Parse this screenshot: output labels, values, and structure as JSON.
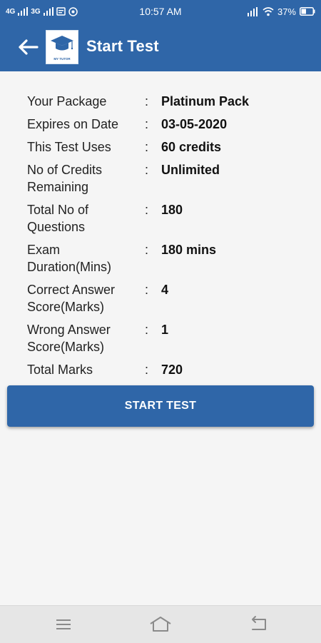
{
  "status_bar": {
    "left_net1": "4G",
    "left_net2": "3G",
    "time": "10:57 AM",
    "battery": "37%"
  },
  "header": {
    "title": "Start Test",
    "logo_text": "MY TUTOR"
  },
  "details": [
    {
      "label": "Your Package",
      "value": "Platinum Pack"
    },
    {
      "label": "Expires on Date",
      "value": "03-05-2020"
    },
    {
      "label": "This Test Uses",
      "value": "60  credits"
    },
    {
      "label": "No of Credits Remaining",
      "value": "Unlimited"
    },
    {
      "label": "Total No of Questions",
      "value": "180"
    },
    {
      "label": "Exam Duration(Mins)",
      "value": "180 mins"
    },
    {
      "label": "Correct Answer Score(Marks)",
      "value": "4"
    },
    {
      "label": "Wrong Answer Score(Marks)",
      "value": "1"
    },
    {
      "label": "Total Marks",
      "value": "720"
    }
  ],
  "separator": ":",
  "start_button": {
    "label": "START TEST"
  },
  "colors": {
    "primary": "#2f66a8",
    "background": "#f5f5f5",
    "nav_bar": "#e6e6e6"
  },
  "icons": {
    "back": "arrow-left-icon",
    "nav_menu": "menu-icon",
    "nav_home": "home-icon",
    "nav_back": "return-icon"
  }
}
